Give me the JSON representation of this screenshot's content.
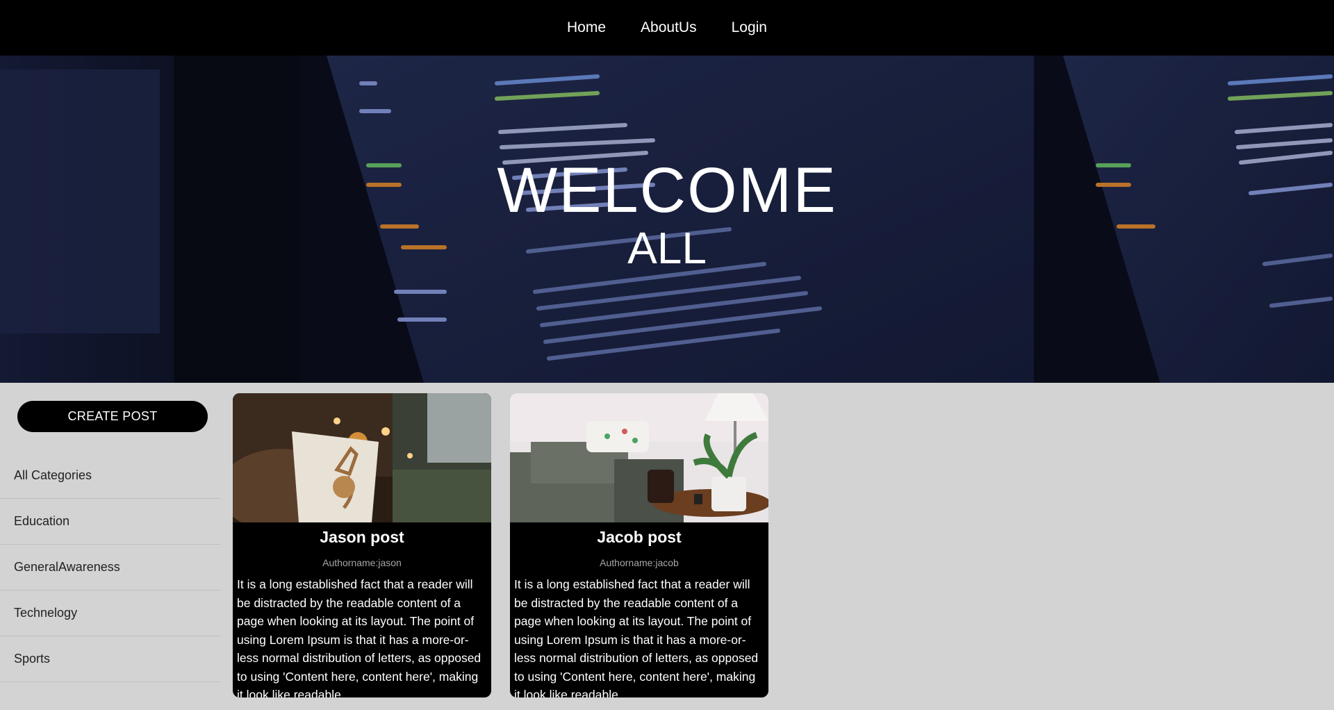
{
  "nav": {
    "items": [
      {
        "label": "Home"
      },
      {
        "label": "AboutUs"
      },
      {
        "label": "Login"
      }
    ]
  },
  "hero": {
    "title": "WELCOME",
    "subtitle": "ALL"
  },
  "sidebar": {
    "create_label": "CREATE POST",
    "categories": [
      {
        "label": "All Categories"
      },
      {
        "label": "Education"
      },
      {
        "label": "GeneralAwareness"
      },
      {
        "label": "Technelogy"
      },
      {
        "label": "Sports"
      }
    ]
  },
  "posts": [
    {
      "title": "Jason post",
      "author": "Authorname:jason",
      "excerpt": "It is a long established fact that a reader will be distracted by the readable content of a page when looking at its layout. The point of using Lorem Ipsum is that it has a more-or-less normal distribution of letters, as opposed to using 'Content here, content here', making it look like readable"
    },
    {
      "title": "Jacob post",
      "author": "Authorname:jacob",
      "excerpt": "It is a long established fact that a reader will be distracted by the readable content of a page when looking at its layout. The point of using Lorem Ipsum is that it has a more-or-less normal distribution of letters, as opposed to using 'Content here, content here', making it look like readable"
    }
  ]
}
